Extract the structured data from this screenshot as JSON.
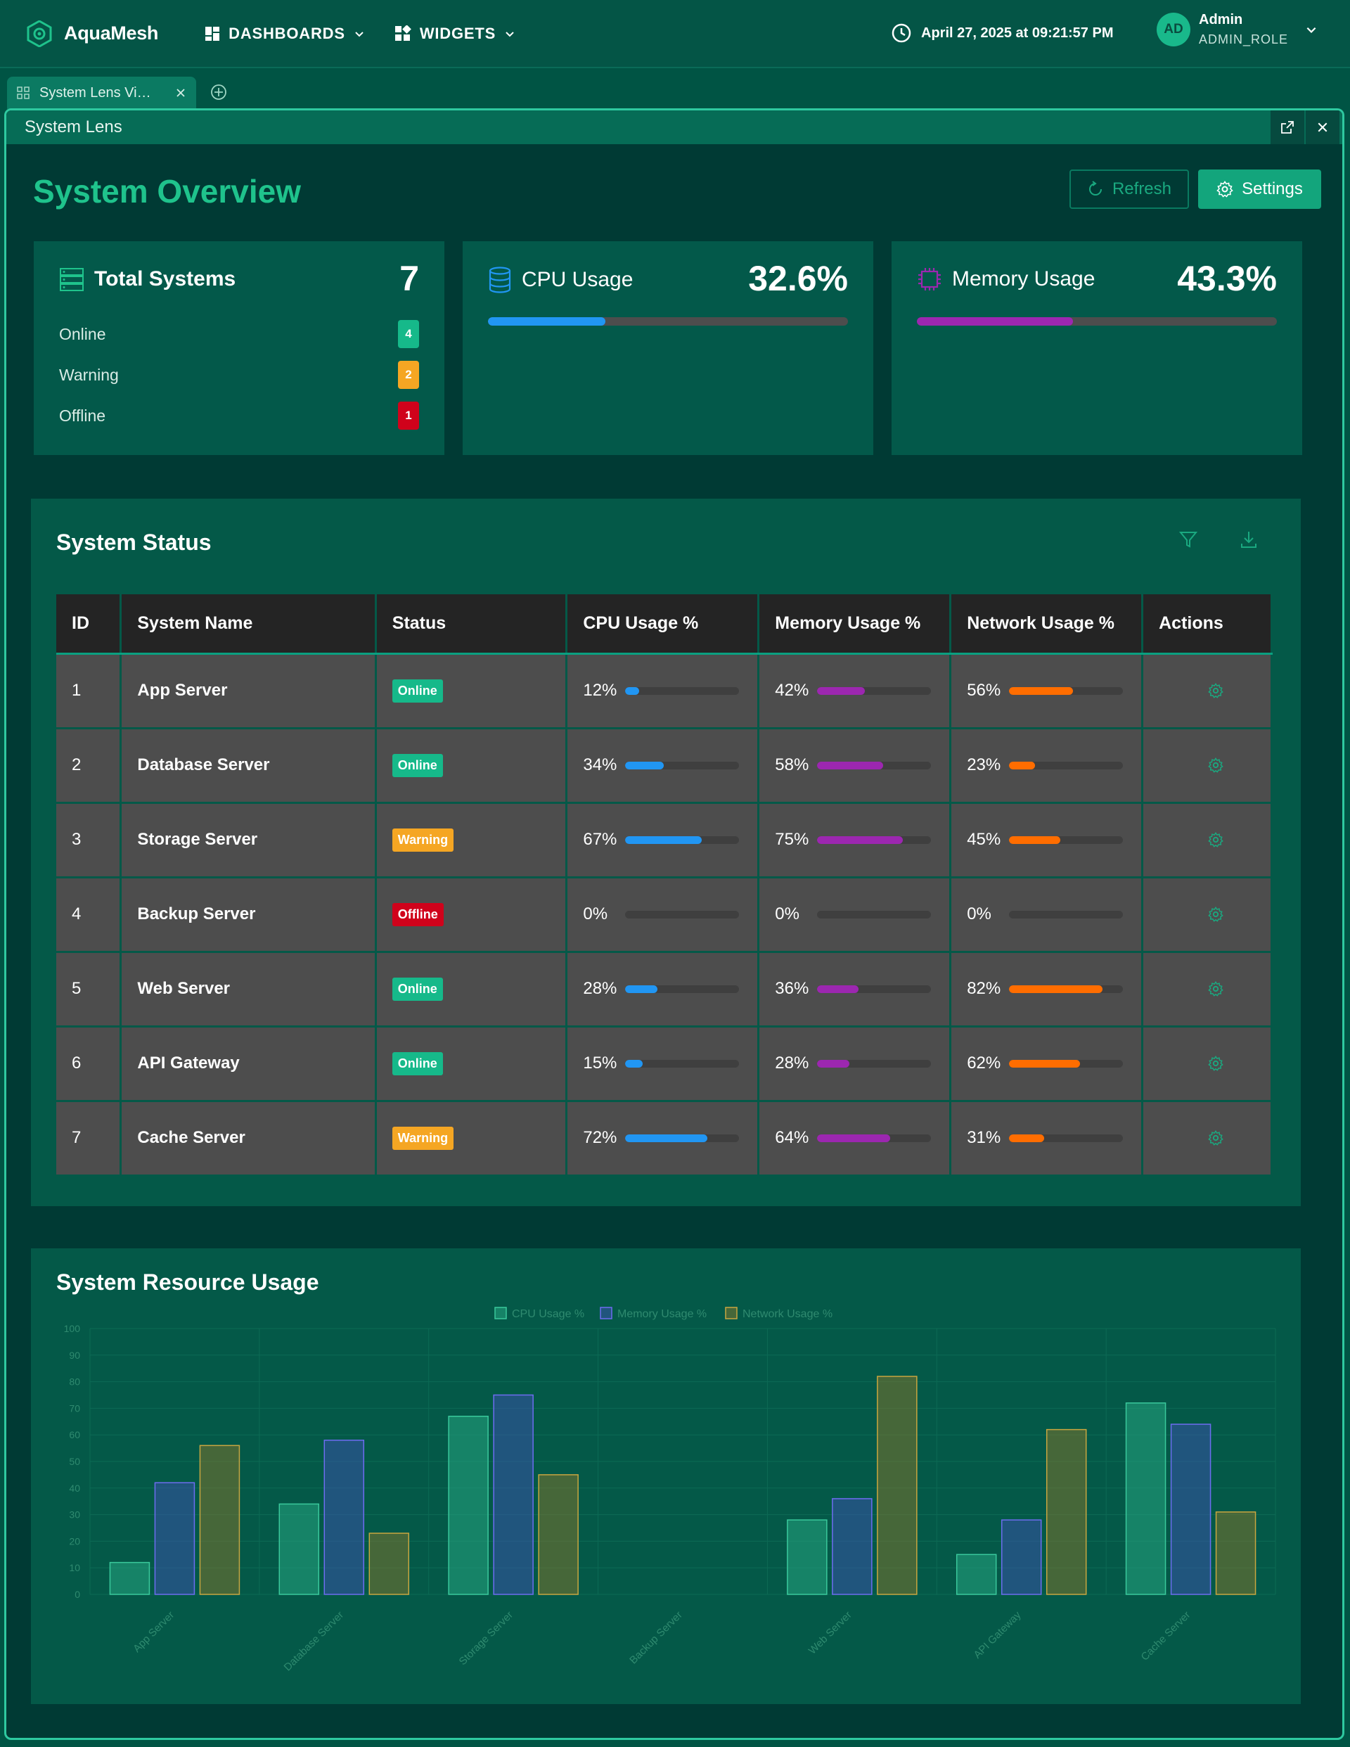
{
  "app": {
    "name": "AquaMesh"
  },
  "nav": {
    "dashboards": "DASHBOARDS",
    "widgets": "WIDGETS"
  },
  "clock": "April 27, 2025 at 09:21:57 PM",
  "user": {
    "initials": "AD",
    "name": "Admin",
    "role": "ADMIN_ROLE"
  },
  "tab": {
    "title": "System Lens Vi…"
  },
  "panel": {
    "title": "System Lens"
  },
  "page": {
    "heading": "System Overview",
    "refresh": "Refresh",
    "settings": "Settings"
  },
  "cards": {
    "total": {
      "title": "Total Systems",
      "value": "7",
      "rows": [
        {
          "label": "Online",
          "count": "4"
        },
        {
          "label": "Warning",
          "count": "2"
        },
        {
          "label": "Offline",
          "count": "1"
        }
      ]
    },
    "cpu": {
      "title": "CPU Usage",
      "value": "32.6%",
      "fraction": 0.326
    },
    "memory": {
      "title": "Memory Usage",
      "value": "43.3%",
      "fraction": 0.433
    }
  },
  "status": {
    "title": "System Status",
    "columns": [
      "ID",
      "System Name",
      "Status",
      "CPU Usage %",
      "Memory Usage %",
      "Network Usage %",
      "Actions"
    ],
    "rows": [
      {
        "id": "1",
        "name": "App Server",
        "status": "Online",
        "cpu": 12,
        "mem": 42,
        "net": 56
      },
      {
        "id": "2",
        "name": "Database Server",
        "status": "Online",
        "cpu": 34,
        "mem": 58,
        "net": 23
      },
      {
        "id": "3",
        "name": "Storage Server",
        "status": "Warning",
        "cpu": 67,
        "mem": 75,
        "net": 45
      },
      {
        "id": "4",
        "name": "Backup Server",
        "status": "Offline",
        "cpu": 0,
        "mem": 0,
        "net": 0
      },
      {
        "id": "5",
        "name": "Web Server",
        "status": "Online",
        "cpu": 28,
        "mem": 36,
        "net": 82
      },
      {
        "id": "6",
        "name": "API Gateway",
        "status": "Online",
        "cpu": 15,
        "mem": 28,
        "net": 62
      },
      {
        "id": "7",
        "name": "Cache Server",
        "status": "Warning",
        "cpu": 72,
        "mem": 64,
        "net": 31
      }
    ]
  },
  "colors": {
    "online": "#16b98a",
    "warning": "#f5a623",
    "offline": "#d0021b",
    "cpu": "#2196f3",
    "mem": "#9c27b0",
    "net": "#ff6d00"
  },
  "chart_data": {
    "type": "bar",
    "title": "System Resource Usage",
    "categories": [
      "App Server",
      "Database Server",
      "Storage Server",
      "Backup Server",
      "Web Server",
      "API Gateway",
      "Cache Server"
    ],
    "series": [
      {
        "name": "CPU Usage %",
        "values": [
          12,
          34,
          67,
          0,
          28,
          15,
          72
        ]
      },
      {
        "name": "Memory Usage %",
        "values": [
          42,
          58,
          75,
          0,
          36,
          28,
          64
        ]
      },
      {
        "name": "Network Usage %",
        "values": [
          56,
          23,
          45,
          0,
          82,
          62,
          31
        ]
      }
    ],
    "ylim": [
      0,
      100
    ],
    "yticks": [
      "0",
      "10",
      "20",
      "30",
      "40",
      "50",
      "60",
      "70",
      "80",
      "90",
      "100"
    ],
    "legend": "top-center",
    "grid": true
  }
}
